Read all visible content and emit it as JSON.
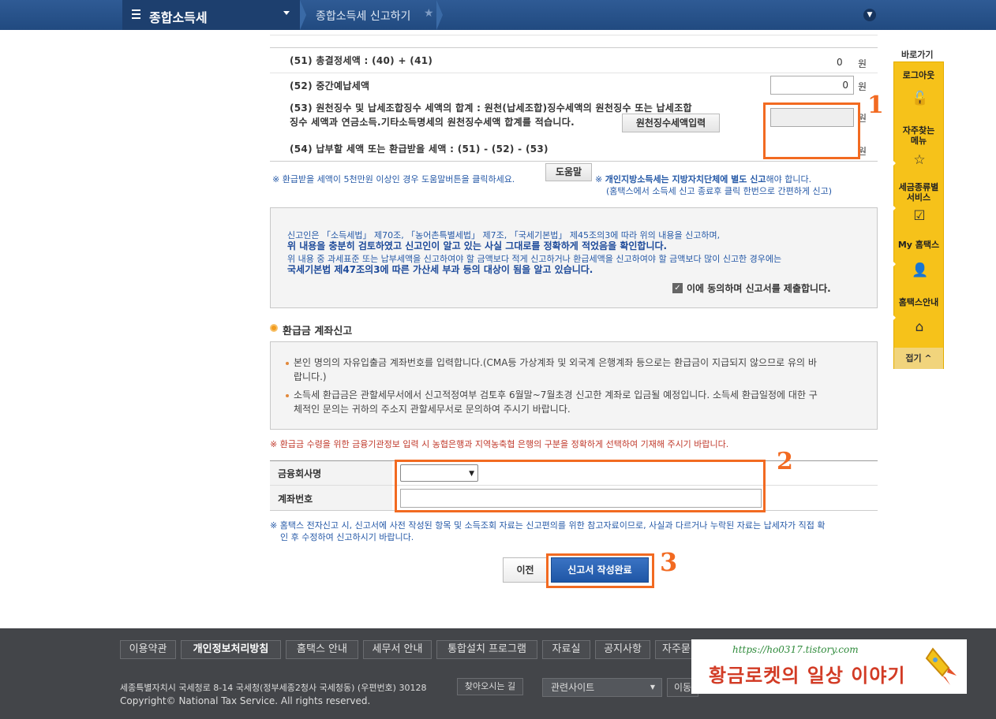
{
  "header": {
    "menu_title": "종합소득세",
    "breadcrumb": "종합소득세 신고하기"
  },
  "rows": {
    "r51": {
      "label": "(51) 총결정세액 : (40) + (41)",
      "value": "0",
      "unit": "원"
    },
    "r52": {
      "label": "(52) 중간예납세액",
      "value": "0",
      "unit": "원"
    },
    "r53": {
      "label_line1": "(53) 원천징수 및 납세조합징수 세액의 합계 : 원천(납세조합)징수세액의 원천징수 또는 납세조합",
      "label_line2": "징수 세액과 연금소득.기타소득명세의 원천징수세액 합계를 적습니다.",
      "button": "원천징수세액입력",
      "unit": "원"
    },
    "r54": {
      "label": "(54) 납부할 세액 또는 환급받을 세액 : (51) - (52) - (53)",
      "unit": "원"
    }
  },
  "notes": {
    "refund_help": "※ 환급받을 세액이 5천만원 이상인 경우 도움말버튼을 클릭하세요.",
    "help_button": "도움말",
    "local_tax_1_prefix": "※ ",
    "local_tax_1_bold": "개인지방소득세는 지방자치단체에 별도 신고",
    "local_tax_1_suffix": "해야 합니다.",
    "local_tax_2": "(홈택스에서 소득세 신고 종료후 클릭 한번으로 간편하게 신고)"
  },
  "consent": {
    "line1": "신고인은 「소득세법」 제70조, 「농어촌특별세법」 제7조, 「국세기본법」 제45조의3에 따라 위의 내용을 신고하며,",
    "line2": "위 내용을 충분히 검토하였고 신고인이 알고 있는 사실 그대로를 정확하게 적었음을 확인합니다.",
    "line3": "위 내용 중 과세표준 또는 납부세액을 신고하여야 할 금액보다 적게 신고하거나 환급세액을 신고하여야 할 금액보다 많이 신고한 경우에는",
    "line4": "국세기본법 제47조의3에 따른 가산세 부과 등의 대상이 됨을 알고 있습니다.",
    "checkbox_label": "이에 동의하며 신고서를 제출합니다."
  },
  "refund_account": {
    "title": "환급금 계좌신고",
    "info1_line1": "본인 명의의 자유입출금 계좌번호를 입력합니다.(CMA등 가상계좌 및 외국계 은행계좌 등으로는 환급금이 지급되지 않으므로 유의 바",
    "info1_line2": "랍니다.)",
    "info2_line1": "소득세 환급금은 관할세무서에서 신고적정여부 검토후 6월말~7월초경 신고한 계좌로 입금될 예정입니다. 소득세 환급일정에 대한 구",
    "info2_line2": "체적인 문의는 귀하의 주소지 관할세무서로 문의하여 주시기 바랍니다.",
    "warning": "※ 환급금 수령을 위한 금융기관정보 입력 시 농협은행과 지역농축협 은행의 구분을 정확하게 선택하여 기재해 주시기 바랍니다.",
    "bank_label": "금융회사명",
    "account_label": "계좌번호",
    "bottom_note_line1": "※ 홈택스 전자신고 시, 신고서에 사전 작성된 항목 및 소득조회 자료는 신고편의를 위한 참고자료이므로, 사실과 다르거나 누락된 자료는 납세자가 직접 확",
    "bottom_note_line2": "인 후 수정하여 신고하시기 바랍니다."
  },
  "buttons": {
    "prev": "이전",
    "submit": "신고서 작성완료"
  },
  "annotations": {
    "n1": "1",
    "n2": "2",
    "n3": "3"
  },
  "quick_menu": {
    "title": "바로가기",
    "items": [
      "로그아웃",
      "자주찾는\n메뉴",
      "세금종류별\n서비스",
      "My 홈택스",
      "홈택스안내"
    ],
    "fold": "접기 ^"
  },
  "footer": {
    "links": [
      "이용약관",
      "개인정보처리방침",
      "홈택스 안내",
      "세무서 안내",
      "통합설치 프로그램",
      "자료실",
      "공지사항",
      "자주묻"
    ],
    "address": "세종특별자치시 국세청로 8-14 국세청(정부세종2청사 국세청동) (우편번호) 30128",
    "find_way": "찾아오시는 길",
    "copyright": "Copyright© National Tax Service. All rights reserved.",
    "related_sites": "관련사이트",
    "move_label": "이동"
  },
  "watermark": {
    "url": "https://ho0317.tistory.com",
    "title": "황금로켓의 일상 이야기"
  },
  "colors": {
    "accent_orange": "#f26a21",
    "header_blue": "#214a80",
    "quick_yellow": "#f6c21a",
    "submit_blue": "#1f56a6"
  }
}
